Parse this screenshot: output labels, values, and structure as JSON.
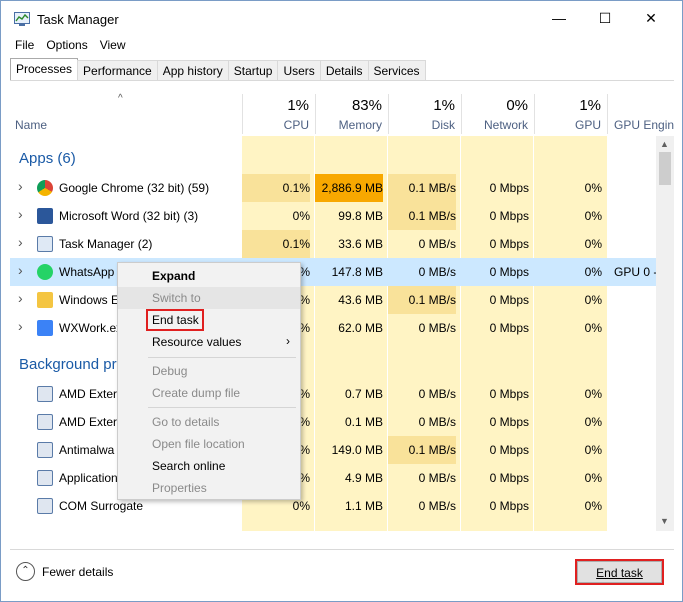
{
  "window": {
    "title": "Task Manager",
    "min": "—",
    "max": "☐",
    "close": "✕"
  },
  "menu": [
    "File",
    "Options",
    "View"
  ],
  "tabs": [
    "Processes",
    "Performance",
    "App history",
    "Startup",
    "Users",
    "Details",
    "Services"
  ],
  "columns": {
    "sort_arrow": "^",
    "name": "Name",
    "cpu": {
      "pct": "1%",
      "label": "CPU"
    },
    "memory": {
      "pct": "83%",
      "label": "Memory"
    },
    "disk": {
      "pct": "1%",
      "label": "Disk"
    },
    "network": {
      "pct": "0%",
      "label": "Network"
    },
    "gpu": {
      "pct": "1%",
      "label": "GPU"
    },
    "gpu_engine": {
      "label": "GPU Engine"
    }
  },
  "groups": {
    "apps": "Apps (6)",
    "background": "Background pr"
  },
  "rows": [
    {
      "name": "Google Chrome (32 bit) (59)",
      "icon": "chrome-icon",
      "cpu": "0.1%",
      "memory": "2,886.9 MB",
      "disk": "0.1 MB/s",
      "network": "0 Mbps",
      "gpu": "0%",
      "gpu_engine": ""
    },
    {
      "name": "Microsoft Word (32 bit) (3)",
      "icon": "word-icon",
      "cpu": "0%",
      "memory": "99.8 MB",
      "disk": "0.1 MB/s",
      "network": "0 Mbps",
      "gpu": "0%",
      "gpu_engine": ""
    },
    {
      "name": "Task Manager (2)",
      "icon": "task-manager-icon",
      "cpu": "0.1%",
      "memory": "33.6 MB",
      "disk": "0 MB/s",
      "network": "0 Mbps",
      "gpu": "0%",
      "gpu_engine": ""
    },
    {
      "name": "WhatsApp",
      "icon": "whatsapp-icon",
      "cpu": "%",
      "memory": "147.8 MB",
      "disk": "0 MB/s",
      "network": "0 Mbps",
      "gpu": "0%",
      "gpu_engine": "GPU 0 -"
    },
    {
      "name": "Windows E",
      "icon": "explorer-icon",
      "cpu": "%",
      "memory": "43.6 MB",
      "disk": "0.1 MB/s",
      "network": "0 Mbps",
      "gpu": "0%",
      "gpu_engine": ""
    },
    {
      "name": "WXWork.ex",
      "icon": "wxwork-icon",
      "cpu": "%",
      "memory": "62.0 MB",
      "disk": "0 MB/s",
      "network": "0 Mbps",
      "gpu": "0%",
      "gpu_engine": ""
    },
    {
      "name": "AMD Extern",
      "icon": "service-icon",
      "cpu": "%",
      "memory": "0.7 MB",
      "disk": "0 MB/s",
      "network": "0 Mbps",
      "gpu": "0%",
      "gpu_engine": ""
    },
    {
      "name": "AMD Extern",
      "icon": "service-icon",
      "cpu": "%",
      "memory": "0.1 MB",
      "disk": "0 MB/s",
      "network": "0 Mbps",
      "gpu": "0%",
      "gpu_engine": ""
    },
    {
      "name": "Antimalwa",
      "icon": "service-icon",
      "cpu": "%",
      "memory": "149.0 MB",
      "disk": "0.1 MB/s",
      "network": "0 Mbps",
      "gpu": "0%",
      "gpu_engine": ""
    },
    {
      "name": "Application",
      "icon": "service-icon",
      "cpu": "%",
      "memory": "4.9 MB",
      "disk": "0 MB/s",
      "network": "0 Mbps",
      "gpu": "0%",
      "gpu_engine": ""
    },
    {
      "name": "COM Surrogate",
      "icon": "service-icon",
      "cpu": "0%",
      "memory": "1.1 MB",
      "disk": "0 MB/s",
      "network": "0 Mbps",
      "gpu": "0%",
      "gpu_engine": ""
    }
  ],
  "context_menu": {
    "expand": "Expand",
    "switch_to": "Switch to",
    "end_task": "End task",
    "resource_values": "Resource values",
    "debug": "Debug",
    "create_dump": "Create dump file",
    "go_to_details": "Go to details",
    "open_file_location": "Open file location",
    "search_online": "Search online",
    "properties": "Properties"
  },
  "footer": {
    "fewer_details": "Fewer details",
    "end_task": "End task"
  },
  "colors": {
    "heat_light": "#fff4c4",
    "heat_hot": "#f8a800",
    "highlight": "#e02020",
    "selected_row": "#cce8ff",
    "group_text": "#1a5aa6"
  }
}
